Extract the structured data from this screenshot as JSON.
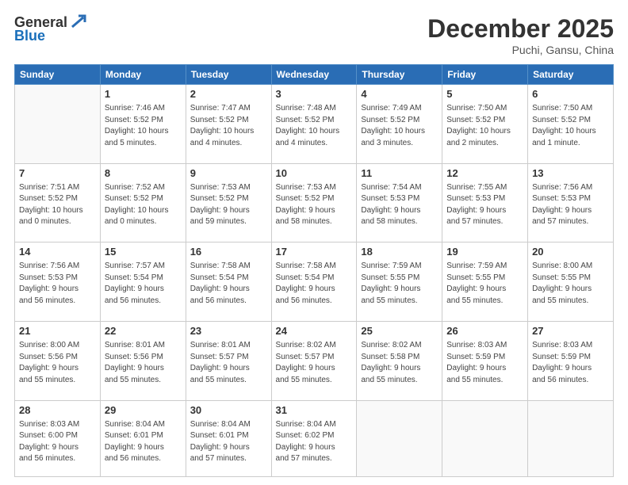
{
  "logo": {
    "general": "General",
    "blue": "Blue"
  },
  "header": {
    "month": "December 2025",
    "location": "Puchi, Gansu, China"
  },
  "weekdays": [
    "Sunday",
    "Monday",
    "Tuesday",
    "Wednesday",
    "Thursday",
    "Friday",
    "Saturday"
  ],
  "weeks": [
    [
      {
        "day": "",
        "info": ""
      },
      {
        "day": "1",
        "info": "Sunrise: 7:46 AM\nSunset: 5:52 PM\nDaylight: 10 hours\nand 5 minutes."
      },
      {
        "day": "2",
        "info": "Sunrise: 7:47 AM\nSunset: 5:52 PM\nDaylight: 10 hours\nand 4 minutes."
      },
      {
        "day": "3",
        "info": "Sunrise: 7:48 AM\nSunset: 5:52 PM\nDaylight: 10 hours\nand 4 minutes."
      },
      {
        "day": "4",
        "info": "Sunrise: 7:49 AM\nSunset: 5:52 PM\nDaylight: 10 hours\nand 3 minutes."
      },
      {
        "day": "5",
        "info": "Sunrise: 7:50 AM\nSunset: 5:52 PM\nDaylight: 10 hours\nand 2 minutes."
      },
      {
        "day": "6",
        "info": "Sunrise: 7:50 AM\nSunset: 5:52 PM\nDaylight: 10 hours\nand 1 minute."
      }
    ],
    [
      {
        "day": "7",
        "info": "Sunrise: 7:51 AM\nSunset: 5:52 PM\nDaylight: 10 hours\nand 0 minutes."
      },
      {
        "day": "8",
        "info": "Sunrise: 7:52 AM\nSunset: 5:52 PM\nDaylight: 10 hours\nand 0 minutes."
      },
      {
        "day": "9",
        "info": "Sunrise: 7:53 AM\nSunset: 5:52 PM\nDaylight: 9 hours\nand 59 minutes."
      },
      {
        "day": "10",
        "info": "Sunrise: 7:53 AM\nSunset: 5:52 PM\nDaylight: 9 hours\nand 58 minutes."
      },
      {
        "day": "11",
        "info": "Sunrise: 7:54 AM\nSunset: 5:53 PM\nDaylight: 9 hours\nand 58 minutes."
      },
      {
        "day": "12",
        "info": "Sunrise: 7:55 AM\nSunset: 5:53 PM\nDaylight: 9 hours\nand 57 minutes."
      },
      {
        "day": "13",
        "info": "Sunrise: 7:56 AM\nSunset: 5:53 PM\nDaylight: 9 hours\nand 57 minutes."
      }
    ],
    [
      {
        "day": "14",
        "info": "Sunrise: 7:56 AM\nSunset: 5:53 PM\nDaylight: 9 hours\nand 56 minutes."
      },
      {
        "day": "15",
        "info": "Sunrise: 7:57 AM\nSunset: 5:54 PM\nDaylight: 9 hours\nand 56 minutes."
      },
      {
        "day": "16",
        "info": "Sunrise: 7:58 AM\nSunset: 5:54 PM\nDaylight: 9 hours\nand 56 minutes."
      },
      {
        "day": "17",
        "info": "Sunrise: 7:58 AM\nSunset: 5:54 PM\nDaylight: 9 hours\nand 56 minutes."
      },
      {
        "day": "18",
        "info": "Sunrise: 7:59 AM\nSunset: 5:55 PM\nDaylight: 9 hours\nand 55 minutes."
      },
      {
        "day": "19",
        "info": "Sunrise: 7:59 AM\nSunset: 5:55 PM\nDaylight: 9 hours\nand 55 minutes."
      },
      {
        "day": "20",
        "info": "Sunrise: 8:00 AM\nSunset: 5:55 PM\nDaylight: 9 hours\nand 55 minutes."
      }
    ],
    [
      {
        "day": "21",
        "info": "Sunrise: 8:00 AM\nSunset: 5:56 PM\nDaylight: 9 hours\nand 55 minutes."
      },
      {
        "day": "22",
        "info": "Sunrise: 8:01 AM\nSunset: 5:56 PM\nDaylight: 9 hours\nand 55 minutes."
      },
      {
        "day": "23",
        "info": "Sunrise: 8:01 AM\nSunset: 5:57 PM\nDaylight: 9 hours\nand 55 minutes."
      },
      {
        "day": "24",
        "info": "Sunrise: 8:02 AM\nSunset: 5:57 PM\nDaylight: 9 hours\nand 55 minutes."
      },
      {
        "day": "25",
        "info": "Sunrise: 8:02 AM\nSunset: 5:58 PM\nDaylight: 9 hours\nand 55 minutes."
      },
      {
        "day": "26",
        "info": "Sunrise: 8:03 AM\nSunset: 5:59 PM\nDaylight: 9 hours\nand 55 minutes."
      },
      {
        "day": "27",
        "info": "Sunrise: 8:03 AM\nSunset: 5:59 PM\nDaylight: 9 hours\nand 56 minutes."
      }
    ],
    [
      {
        "day": "28",
        "info": "Sunrise: 8:03 AM\nSunset: 6:00 PM\nDaylight: 9 hours\nand 56 minutes."
      },
      {
        "day": "29",
        "info": "Sunrise: 8:04 AM\nSunset: 6:01 PM\nDaylight: 9 hours\nand 56 minutes."
      },
      {
        "day": "30",
        "info": "Sunrise: 8:04 AM\nSunset: 6:01 PM\nDaylight: 9 hours\nand 57 minutes."
      },
      {
        "day": "31",
        "info": "Sunrise: 8:04 AM\nSunset: 6:02 PM\nDaylight: 9 hours\nand 57 minutes."
      },
      {
        "day": "",
        "info": ""
      },
      {
        "day": "",
        "info": ""
      },
      {
        "day": "",
        "info": ""
      }
    ]
  ]
}
